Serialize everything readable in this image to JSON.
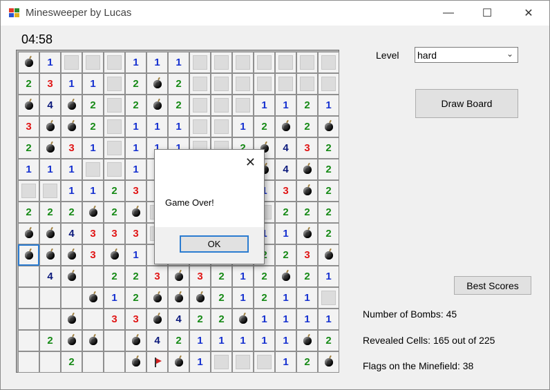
{
  "window": {
    "title": "Minesweeper by Lucas",
    "minimize": "—",
    "maximize": "☐",
    "close": "✕"
  },
  "game": {
    "timer": "04:58",
    "level_label": "Level",
    "level_value": "hard",
    "draw_button": "Draw Board",
    "best_scores_button": "Best Scores",
    "bombs_text": "Number of Bombs: 45",
    "revealed_text": "Revealed Cells: 165 out of 225",
    "flags_text": "Flags on the Minefield: 38"
  },
  "board": {
    "rows": [
      [
        "b",
        "1",
        "h",
        "h",
        "h",
        "1",
        "1",
        "1",
        "h",
        "h",
        "h",
        "h",
        "h",
        "h",
        "h"
      ],
      [
        "2",
        "3",
        "1",
        "1",
        "h",
        "2",
        "b",
        "2",
        "h",
        "h",
        "h",
        "h",
        "h",
        "h",
        "h"
      ],
      [
        "b",
        "4",
        "b",
        "2",
        "h",
        "2",
        "b",
        "2",
        "h",
        "h",
        "h",
        "1",
        "1",
        "2",
        "1"
      ],
      [
        "3",
        "b",
        "b",
        "2",
        "h",
        "1",
        "1",
        "1",
        "h",
        "h",
        "1",
        "2",
        "b",
        "2",
        "b"
      ],
      [
        "2",
        "b",
        "3",
        "1",
        "h",
        "1",
        "1",
        "1",
        "h",
        "h",
        "2",
        "b",
        "4",
        "3",
        "2"
      ],
      [
        "1",
        "1",
        "1",
        "h",
        "h",
        "1",
        "4",
        "h",
        "h",
        "h",
        "h",
        "b",
        "4",
        "b",
        "2"
      ],
      [
        "h",
        "h",
        "1",
        "1",
        "2",
        "3",
        "4",
        "h",
        "h",
        "h",
        "h",
        "1",
        "3",
        "b",
        "2"
      ],
      [
        "2",
        "2",
        "2",
        "b",
        "2",
        "b",
        "h",
        "h",
        "h",
        "h",
        "h",
        "h",
        "2",
        "2",
        "2"
      ],
      [
        "b",
        "b",
        "4",
        "3",
        "3",
        "3",
        "h",
        "h",
        "h",
        "h",
        "h",
        "1",
        "1",
        "b",
        "2"
      ],
      [
        "b",
        "b",
        "b",
        "3",
        "b",
        "1",
        "1",
        "h",
        "h",
        "h",
        "h",
        "2",
        "2",
        "3",
        "b"
      ],
      [
        "e",
        "4",
        "b",
        "e",
        "2",
        "2",
        "3",
        "b",
        "3",
        "2",
        "1",
        "2",
        "b",
        "2",
        "1"
      ],
      [
        "e",
        "e",
        "e",
        "b",
        "1",
        "2",
        "b",
        "b",
        "b",
        "2",
        "1",
        "2",
        "1",
        "1",
        "h"
      ],
      [
        "e",
        "e",
        "b",
        "e",
        "3",
        "3",
        "b",
        "4",
        "2",
        "2",
        "b",
        "1",
        "1",
        "1",
        "1"
      ],
      [
        "e",
        "2",
        "b",
        "b",
        "e",
        "b",
        "4",
        "2",
        "1",
        "1",
        "1",
        "1",
        "1",
        "b",
        "2"
      ],
      [
        "e",
        "e",
        "2",
        "e",
        "e",
        "b",
        "f",
        "b",
        "1",
        "h",
        "h",
        "h",
        "1",
        "2",
        "b"
      ]
    ],
    "selected": "9,0"
  },
  "dialog": {
    "message": "Game Over!",
    "ok_label": "OK",
    "close_label": "✕"
  }
}
